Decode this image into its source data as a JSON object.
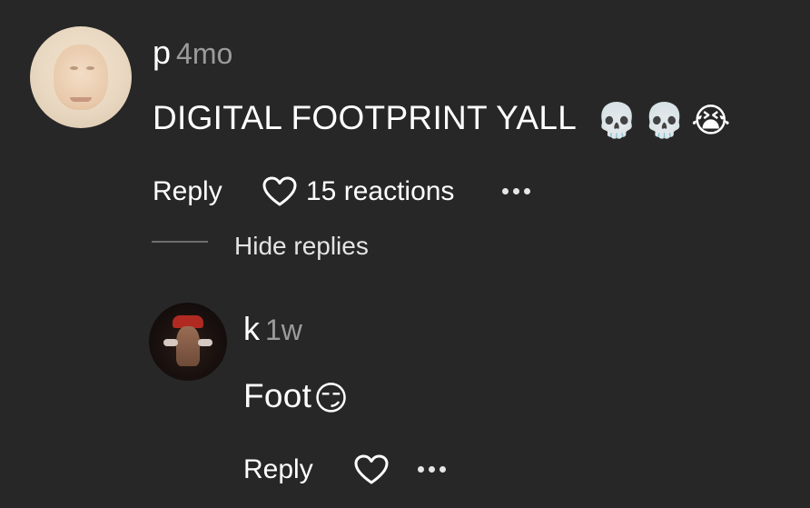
{
  "comment": {
    "username": "p",
    "timestamp": "4mo",
    "text": "DIGITAL FOOTPRINT YALL",
    "emojis": [
      "💀",
      "💀",
      "😭"
    ],
    "actions": {
      "reply_label": "Reply",
      "reactions_label": "15 reactions"
    },
    "hide_replies_label": "Hide replies"
  },
  "reply": {
    "username": "k",
    "timestamp": "1w",
    "text": "Foot",
    "emoji": "😏",
    "actions": {
      "reply_label": "Reply"
    }
  },
  "icons": {
    "heart": "heart-outline-icon",
    "more": "more-horizontal-icon"
  },
  "colors": {
    "background": "#272727",
    "text": "#ffffff",
    "muted": "#9b9b9b"
  }
}
